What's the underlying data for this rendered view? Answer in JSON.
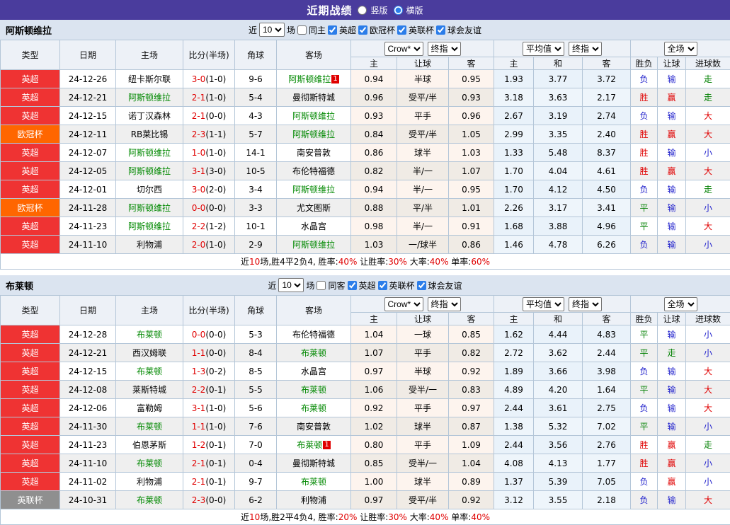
{
  "title_bar": {
    "title": "近期战绩",
    "vertical_label": "竖版",
    "horizontal_label": "横版",
    "selected_layout": "horizontal"
  },
  "table_header": {
    "static_cols": [
      "类型",
      "日期",
      "主场",
      "比分(半场)",
      "角球",
      "客场"
    ],
    "sub_cols": [
      "主",
      "让球",
      "客",
      "主",
      "和",
      "客",
      "胜负",
      "让球",
      "进球数"
    ],
    "selects": {
      "crow_company": "Crow*",
      "crow_time": "终指",
      "avg_company": "平均值",
      "avg_time": "终指",
      "scope": "全场"
    }
  },
  "colors": {
    "league": {
      "英超": "#ef3333",
      "欧冠杯": "#ff6600",
      "英联杯": "#8f8f8f"
    },
    "text": {
      "r": "#e00000",
      "b": "#2222cc",
      "g": "#008000",
      "k": "#000000"
    },
    "accent": "#2b7de9",
    "title_bar_bg": "#4a3c9d"
  },
  "sections": [
    {
      "team": "阿斯顿维拉",
      "filter": {
        "near_label": "近",
        "count": "10",
        "matches_label": "场",
        "venue_label": "同主",
        "venue_checked": false,
        "leagues": [
          {
            "label": "英超",
            "checked": true
          },
          {
            "label": "欧冠杯",
            "checked": true
          },
          {
            "label": "英联杯",
            "checked": true
          },
          {
            "label": "球会友谊",
            "checked": true
          }
        ]
      },
      "rows": [
        {
          "league": "英超",
          "date": "24-12-26",
          "home": "纽卡斯尔联",
          "home_hl": false,
          "home_badge": "",
          "ft": "3-0",
          "ht": "(1-0)",
          "corner": "9-6",
          "away": "阿斯顿维拉",
          "away_hl": true,
          "away_badge": "1",
          "crow": [
            "0.94",
            "半球",
            "0.95"
          ],
          "avg": [
            "1.93",
            "3.77",
            "3.72"
          ],
          "outcome": [
            "负",
            "b"
          ],
          "handicap": [
            "输",
            "b"
          ],
          "goals": [
            "走",
            "g"
          ]
        },
        {
          "league": "英超",
          "date": "24-12-21",
          "home": "阿斯顿维拉",
          "home_hl": true,
          "home_badge": "",
          "ft": "2-1",
          "ht": "(1-0)",
          "corner": "5-4",
          "away": "曼彻斯特城",
          "away_hl": false,
          "away_badge": "",
          "crow": [
            "0.96",
            "受平/半",
            "0.93"
          ],
          "avg": [
            "3.18",
            "3.63",
            "2.17"
          ],
          "outcome": [
            "胜",
            "r"
          ],
          "handicap": [
            "赢",
            "r"
          ],
          "goals": [
            "走",
            "g"
          ]
        },
        {
          "league": "英超",
          "date": "24-12-15",
          "home": "诺丁汉森林",
          "home_hl": false,
          "home_badge": "",
          "ft": "2-1",
          "ht": "(0-0)",
          "corner": "4-3",
          "away": "阿斯顿维拉",
          "away_hl": true,
          "away_badge": "",
          "crow": [
            "0.93",
            "平手",
            "0.96"
          ],
          "avg": [
            "2.67",
            "3.19",
            "2.74"
          ],
          "outcome": [
            "负",
            "b"
          ],
          "handicap": [
            "输",
            "b"
          ],
          "goals": [
            "大",
            "r"
          ]
        },
        {
          "league": "欧冠杯",
          "date": "24-12-11",
          "home": "RB莱比锡",
          "home_hl": false,
          "home_badge": "",
          "ft": "2-3",
          "ht": "(1-1)",
          "corner": "5-7",
          "away": "阿斯顿维拉",
          "away_hl": true,
          "away_badge": "",
          "crow": [
            "0.84",
            "受平/半",
            "1.05"
          ],
          "avg": [
            "2.99",
            "3.35",
            "2.40"
          ],
          "outcome": [
            "胜",
            "r"
          ],
          "handicap": [
            "赢",
            "r"
          ],
          "goals": [
            "大",
            "r"
          ]
        },
        {
          "league": "英超",
          "date": "24-12-07",
          "home": "阿斯顿维拉",
          "home_hl": true,
          "home_badge": "",
          "ft": "1-0",
          "ht": "(1-0)",
          "corner": "14-1",
          "away": "南安普敦",
          "away_hl": false,
          "away_badge": "",
          "crow": [
            "0.86",
            "球半",
            "1.03"
          ],
          "avg": [
            "1.33",
            "5.48",
            "8.37"
          ],
          "outcome": [
            "胜",
            "r"
          ],
          "handicap": [
            "输",
            "b"
          ],
          "goals": [
            "小",
            "b"
          ]
        },
        {
          "league": "英超",
          "date": "24-12-05",
          "home": "阿斯顿维拉",
          "home_hl": true,
          "home_badge": "",
          "ft": "3-1",
          "ht": "(3-0)",
          "corner": "10-5",
          "away": "布伦特福德",
          "away_hl": false,
          "away_badge": "",
          "crow": [
            "0.82",
            "半/一",
            "1.07"
          ],
          "avg": [
            "1.70",
            "4.04",
            "4.61"
          ],
          "outcome": [
            "胜",
            "r"
          ],
          "handicap": [
            "赢",
            "r"
          ],
          "goals": [
            "大",
            "r"
          ]
        },
        {
          "league": "英超",
          "date": "24-12-01",
          "home": "切尔西",
          "home_hl": false,
          "home_badge": "",
          "ft": "3-0",
          "ht": "(2-0)",
          "corner": "3-4",
          "away": "阿斯顿维拉",
          "away_hl": true,
          "away_badge": "",
          "crow": [
            "0.94",
            "半/一",
            "0.95"
          ],
          "avg": [
            "1.70",
            "4.12",
            "4.50"
          ],
          "outcome": [
            "负",
            "b"
          ],
          "handicap": [
            "输",
            "b"
          ],
          "goals": [
            "走",
            "g"
          ]
        },
        {
          "league": "欧冠杯",
          "date": "24-11-28",
          "home": "阿斯顿维拉",
          "home_hl": true,
          "home_badge": "",
          "ft": "0-0",
          "ht": "(0-0)",
          "corner": "3-3",
          "away": "尤文图斯",
          "away_hl": false,
          "away_badge": "",
          "crow": [
            "0.88",
            "平/半",
            "1.01"
          ],
          "avg": [
            "2.26",
            "3.17",
            "3.41"
          ],
          "outcome": [
            "平",
            "g"
          ],
          "handicap": [
            "输",
            "b"
          ],
          "goals": [
            "小",
            "b"
          ]
        },
        {
          "league": "英超",
          "date": "24-11-23",
          "home": "阿斯顿维拉",
          "home_hl": true,
          "home_badge": "",
          "ft": "2-2",
          "ht": "(1-2)",
          "corner": "10-1",
          "away": "水晶宫",
          "away_hl": false,
          "away_badge": "",
          "crow": [
            "0.98",
            "半/一",
            "0.91"
          ],
          "avg": [
            "1.68",
            "3.88",
            "4.96"
          ],
          "outcome": [
            "平",
            "g"
          ],
          "handicap": [
            "输",
            "b"
          ],
          "goals": [
            "大",
            "r"
          ]
        },
        {
          "league": "英超",
          "date": "24-11-10",
          "home": "利物浦",
          "home_hl": false,
          "home_badge": "",
          "ft": "2-0",
          "ht": "(1-0)",
          "corner": "2-9",
          "away": "阿斯顿维拉",
          "away_hl": true,
          "away_badge": "",
          "crow": [
            "1.03",
            "一/球半",
            "0.86"
          ],
          "avg": [
            "1.46",
            "4.78",
            "6.26"
          ],
          "outcome": [
            "负",
            "b"
          ],
          "handicap": [
            "输",
            "b"
          ],
          "goals": [
            "小",
            "b"
          ]
        }
      ],
      "summary": [
        [
          "近",
          "k"
        ],
        [
          "10",
          "r"
        ],
        [
          "场,胜4平2负4, 胜率:",
          "k"
        ],
        [
          "40%",
          "r"
        ],
        [
          " 让胜率:",
          "k"
        ],
        [
          "30%",
          "r"
        ],
        [
          " 大率:",
          "k"
        ],
        [
          "40%",
          "r"
        ],
        [
          " 单率:",
          "k"
        ],
        [
          "60%",
          "r"
        ]
      ]
    },
    {
      "team": "布莱顿",
      "filter": {
        "near_label": "近",
        "count": "10",
        "matches_label": "场",
        "venue_label": "同客",
        "venue_checked": false,
        "leagues": [
          {
            "label": "英超",
            "checked": true
          },
          {
            "label": "英联杯",
            "checked": true
          },
          {
            "label": "球会友谊",
            "checked": true
          }
        ]
      },
      "rows": [
        {
          "league": "英超",
          "date": "24-12-28",
          "home": "布莱顿",
          "home_hl": true,
          "home_badge": "",
          "ft": "0-0",
          "ht": "(0-0)",
          "corner": "5-3",
          "away": "布伦特福德",
          "away_hl": false,
          "away_badge": "",
          "crow": [
            "1.04",
            "一球",
            "0.85"
          ],
          "avg": [
            "1.62",
            "4.44",
            "4.83"
          ],
          "outcome": [
            "平",
            "g"
          ],
          "handicap": [
            "输",
            "b"
          ],
          "goals": [
            "小",
            "b"
          ]
        },
        {
          "league": "英超",
          "date": "24-12-21",
          "home": "西汉姆联",
          "home_hl": false,
          "home_badge": "",
          "ft": "1-1",
          "ht": "(0-0)",
          "corner": "8-4",
          "away": "布莱顿",
          "away_hl": true,
          "away_badge": "",
          "crow": [
            "1.07",
            "平手",
            "0.82"
          ],
          "avg": [
            "2.72",
            "3.62",
            "2.44"
          ],
          "outcome": [
            "平",
            "g"
          ],
          "handicap": [
            "走",
            "g"
          ],
          "goals": [
            "小",
            "b"
          ]
        },
        {
          "league": "英超",
          "date": "24-12-15",
          "home": "布莱顿",
          "home_hl": true,
          "home_badge": "",
          "ft": "1-3",
          "ht": "(0-2)",
          "corner": "8-5",
          "away": "水晶宫",
          "away_hl": false,
          "away_badge": "",
          "crow": [
            "0.97",
            "半球",
            "0.92"
          ],
          "avg": [
            "1.89",
            "3.66",
            "3.98"
          ],
          "outcome": [
            "负",
            "b"
          ],
          "handicap": [
            "输",
            "b"
          ],
          "goals": [
            "大",
            "r"
          ]
        },
        {
          "league": "英超",
          "date": "24-12-08",
          "home": "莱斯特城",
          "home_hl": false,
          "home_badge": "",
          "ft": "2-2",
          "ht": "(0-1)",
          "corner": "5-5",
          "away": "布莱顿",
          "away_hl": true,
          "away_badge": "",
          "crow": [
            "1.06",
            "受半/一",
            "0.83"
          ],
          "avg": [
            "4.89",
            "4.20",
            "1.64"
          ],
          "outcome": [
            "平",
            "g"
          ],
          "handicap": [
            "输",
            "b"
          ],
          "goals": [
            "大",
            "r"
          ]
        },
        {
          "league": "英超",
          "date": "24-12-06",
          "home": "富勒姆",
          "home_hl": false,
          "home_badge": "",
          "ft": "3-1",
          "ht": "(1-0)",
          "corner": "5-6",
          "away": "布莱顿",
          "away_hl": true,
          "away_badge": "",
          "crow": [
            "0.92",
            "平手",
            "0.97"
          ],
          "avg": [
            "2.44",
            "3.61",
            "2.75"
          ],
          "outcome": [
            "负",
            "b"
          ],
          "handicap": [
            "输",
            "b"
          ],
          "goals": [
            "大",
            "r"
          ]
        },
        {
          "league": "英超",
          "date": "24-11-30",
          "home": "布莱顿",
          "home_hl": true,
          "home_badge": "",
          "ft": "1-1",
          "ht": "(1-0)",
          "corner": "7-6",
          "away": "南安普敦",
          "away_hl": false,
          "away_badge": "",
          "crow": [
            "1.02",
            "球半",
            "0.87"
          ],
          "avg": [
            "1.38",
            "5.32",
            "7.02"
          ],
          "outcome": [
            "平",
            "g"
          ],
          "handicap": [
            "输",
            "b"
          ],
          "goals": [
            "小",
            "b"
          ]
        },
        {
          "league": "英超",
          "date": "24-11-23",
          "home": "伯恩茅斯",
          "home_hl": false,
          "home_badge": "",
          "ft": "1-2",
          "ht": "(0-1)",
          "corner": "7-0",
          "away": "布莱顿",
          "away_hl": true,
          "away_badge": "1",
          "crow": [
            "0.80",
            "平手",
            "1.09"
          ],
          "avg": [
            "2.44",
            "3.56",
            "2.76"
          ],
          "outcome": [
            "胜",
            "r"
          ],
          "handicap": [
            "赢",
            "r"
          ],
          "goals": [
            "走",
            "g"
          ]
        },
        {
          "league": "英超",
          "date": "24-11-10",
          "home": "布莱顿",
          "home_hl": true,
          "home_badge": "",
          "ft": "2-1",
          "ht": "(0-1)",
          "corner": "0-4",
          "away": "曼彻斯特城",
          "away_hl": false,
          "away_badge": "",
          "crow": [
            "0.85",
            "受半/一",
            "1.04"
          ],
          "avg": [
            "4.08",
            "4.13",
            "1.77"
          ],
          "outcome": [
            "胜",
            "r"
          ],
          "handicap": [
            "赢",
            "r"
          ],
          "goals": [
            "小",
            "b"
          ]
        },
        {
          "league": "英超",
          "date": "24-11-02",
          "home": "利物浦",
          "home_hl": false,
          "home_badge": "",
          "ft": "2-1",
          "ht": "(0-1)",
          "corner": "9-7",
          "away": "布莱顿",
          "away_hl": true,
          "away_badge": "",
          "crow": [
            "1.00",
            "球半",
            "0.89"
          ],
          "avg": [
            "1.37",
            "5.39",
            "7.05"
          ],
          "outcome": [
            "负",
            "b"
          ],
          "handicap": [
            "赢",
            "r"
          ],
          "goals": [
            "小",
            "b"
          ]
        },
        {
          "league": "英联杯",
          "date": "24-10-31",
          "home": "布莱顿",
          "home_hl": true,
          "home_badge": "",
          "ft": "2-3",
          "ht": "(0-0)",
          "corner": "6-2",
          "away": "利物浦",
          "away_hl": false,
          "away_badge": "",
          "crow": [
            "0.97",
            "受平/半",
            "0.92"
          ],
          "avg": [
            "3.12",
            "3.55",
            "2.18"
          ],
          "outcome": [
            "负",
            "b"
          ],
          "handicap": [
            "输",
            "b"
          ],
          "goals": [
            "大",
            "r"
          ]
        }
      ],
      "summary": [
        [
          "近",
          "k"
        ],
        [
          "10",
          "r"
        ],
        [
          "场,胜2平4负4, 胜率:",
          "k"
        ],
        [
          "20%",
          "r"
        ],
        [
          " 让胜率:",
          "k"
        ],
        [
          "30%",
          "r"
        ],
        [
          " 大率:",
          "k"
        ],
        [
          "40%",
          "r"
        ],
        [
          " 单率:",
          "k"
        ],
        [
          "40%",
          "r"
        ]
      ]
    }
  ]
}
